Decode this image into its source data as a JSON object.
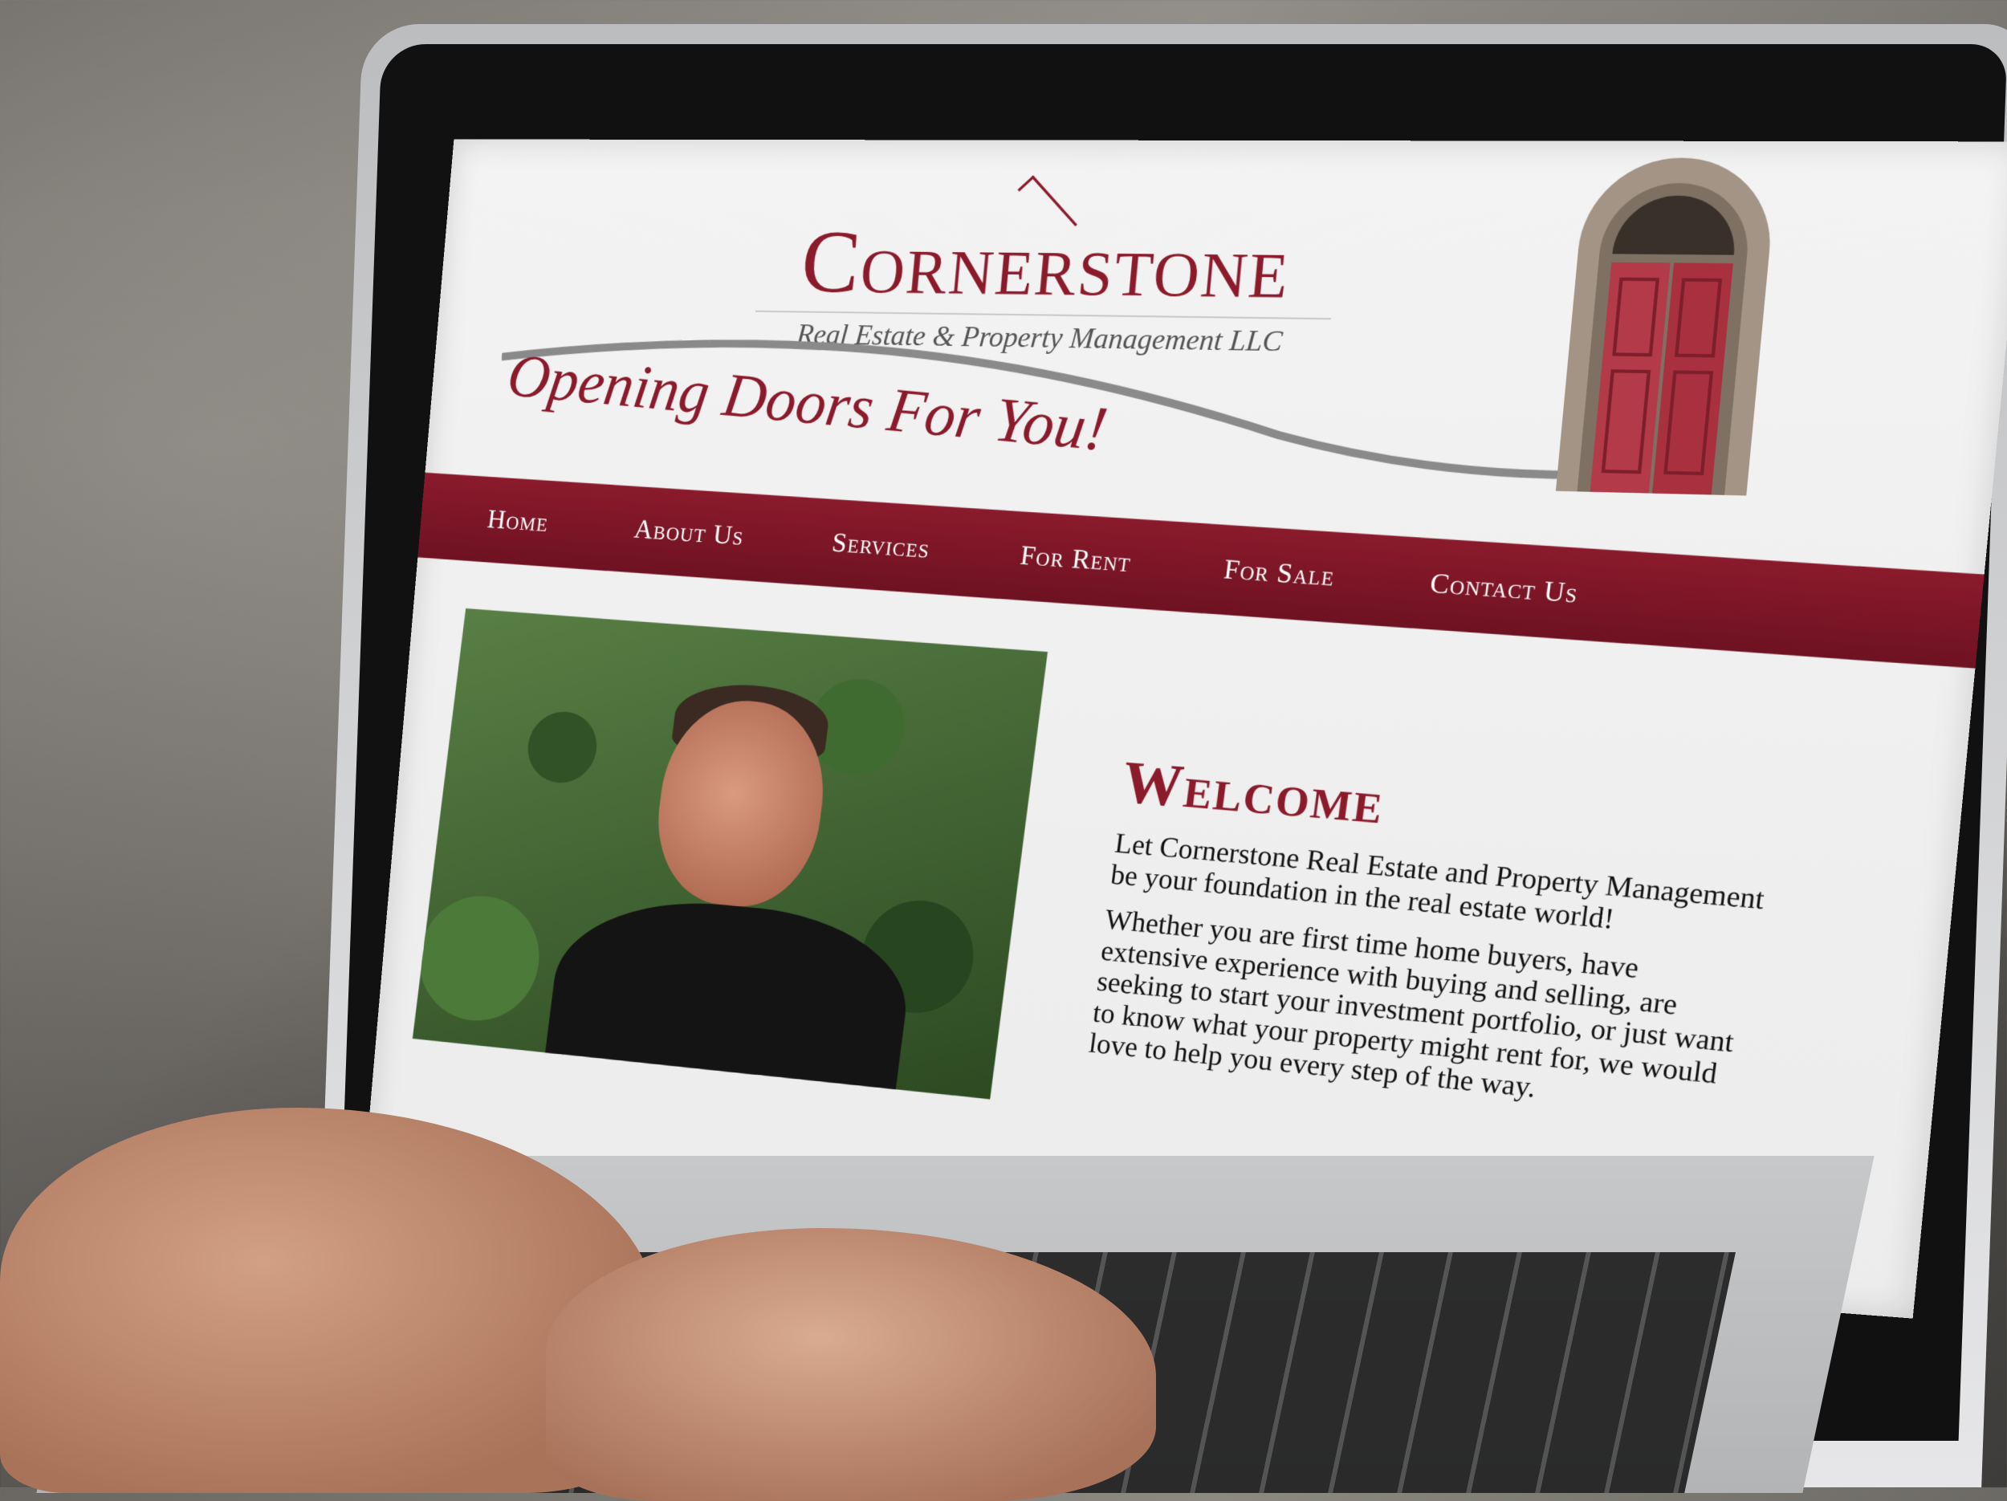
{
  "logo": {
    "name": "Cornerstone",
    "subtitle": "Real Estate & Property Management LLC"
  },
  "tagline": "Opening Doors For You!",
  "nav": {
    "items": [
      {
        "label": "Home"
      },
      {
        "label": "About Us"
      },
      {
        "label": "Services"
      },
      {
        "label": "For Rent"
      },
      {
        "label": "For Sale"
      },
      {
        "label": "Contact Us"
      }
    ]
  },
  "welcome": {
    "heading": "Welcome",
    "paragraph1": "Let Cornerstone Real Estate and Property Management be your foundation in the real estate world!",
    "paragraph2": "Whether you are first time home buyers, have extensive experience with buying and selling, are seeking to start your investment portfolio, or just want to know what your property might rent for, we would love to help you every step of the way."
  },
  "colors": {
    "brand": "#8b1a2b",
    "nav_bg": "#7a1626",
    "page_bg": "#efefef",
    "door_red": "#b33a48"
  }
}
